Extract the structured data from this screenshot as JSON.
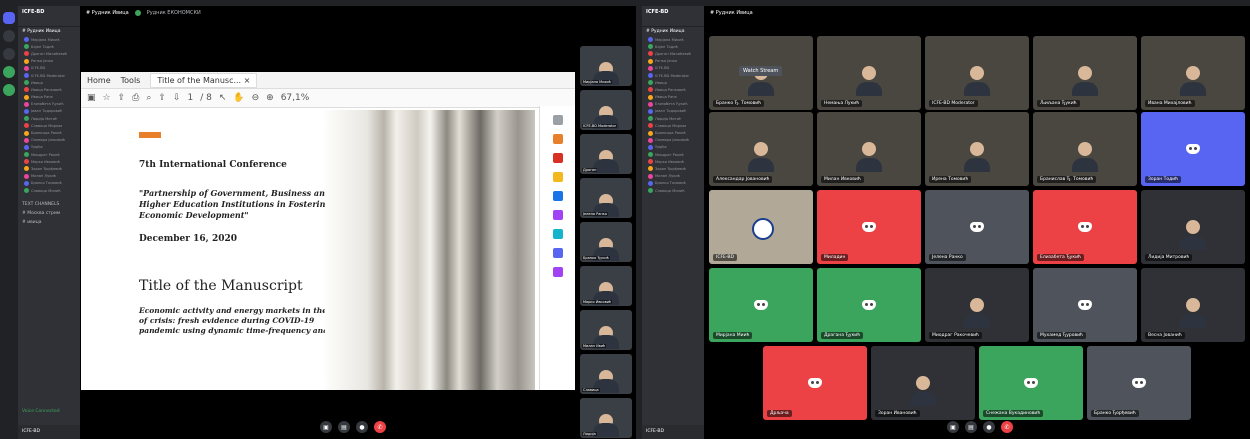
{
  "left": {
    "server_name": "ICFE-BD",
    "stage_title": "# Рудник Ивица",
    "stage_live": "Рудник ЕКОНОМСКИ",
    "voice_users": [
      "Мирјана Михић",
      "Бојан Тодић",
      "Драган Милићевић",
      "Ранко Јанко",
      "ICFE-BD",
      "ICFE-BD Moderator",
      "Ивица",
      "Ивица Ранковић",
      "Ивица Ранк",
      "Елизабета Ђукић",
      "Јован Тодоровић",
      "Лидија Митић",
      "Славица Мирков",
      "Бранкица Ракић",
      "Оливера Јанковић",
      "Ђорђе",
      "Миодраг Ракић",
      "Марко Ивковић",
      "Зоран Ђорђевић",
      "Милан Лукић",
      "Бранко Томовић",
      "Славица Милић"
    ],
    "section_label": "TEXT CHANNELS",
    "channel_1": "# Москва стрим",
    "channel_2": "# ивица",
    "user_status": "Voice Connected",
    "user_name": "ICFE-BD"
  },
  "pdf": {
    "tabs": [
      "Home",
      "Tools",
      "Title of the Manusc... ×"
    ],
    "page_num": "1",
    "page_total": "/ 8",
    "zoom": "67,1%",
    "conference": "7th International Conference",
    "quote": "\"Partnership of Government, Business and Higher Education Institutions in Fostering Economic Development\"",
    "date": "December 16, 2020",
    "manuscript_title": "Title of the Manuscript",
    "abstract": "Economic activity and energy markets in the time of crisis: fresh evidence during COVID-19 pandemic using dynamic time-frequency analysis"
  },
  "side_videos": [
    "Мирјана Михић",
    "ICFE-BD Moderator",
    "Драган",
    "Јелена Ранко",
    "Бранко Ђукић",
    "Марко Ивковић",
    "Милан Ивић",
    "Славица",
    "Лидија"
  ],
  "right": {
    "server_name": "ICFE-BD",
    "stage_title": "# Рудник Ивица",
    "watch_stream": "Watch Stream",
    "tiles_row1": [
      "Бранко Ђ. Томовић",
      "Немања Лукић",
      "ICFE-BD Moderator",
      "Љиљана Ђукић",
      "Ивана Михајловић"
    ],
    "tiles_row2": [
      "Александар Јовановић",
      "Милан Ивковић",
      "Ирена Томовић",
      "Бранислав Ђ. Томовић",
      "Зоран Тодић"
    ],
    "tiles_row3": [
      "ICFE-BD",
      "Миладин",
      "Јелена Ранко",
      "Елизабета Ђукић",
      "Лидија Митровић"
    ],
    "tiles_row4": [
      "Мирјана Миић",
      "Драгана Ђукић",
      "Миодраг Ракочевић",
      "Мухамед Ђуровић",
      "Весна Јованић"
    ],
    "tiles_row5": [
      "Дрљача",
      "Зоран Ивановић",
      "Снежана Вукадиновић",
      "Бранко Ђорђевић"
    ],
    "accent": "#5865f2",
    "red": "#ed4245",
    "green": "#3ba55d"
  }
}
